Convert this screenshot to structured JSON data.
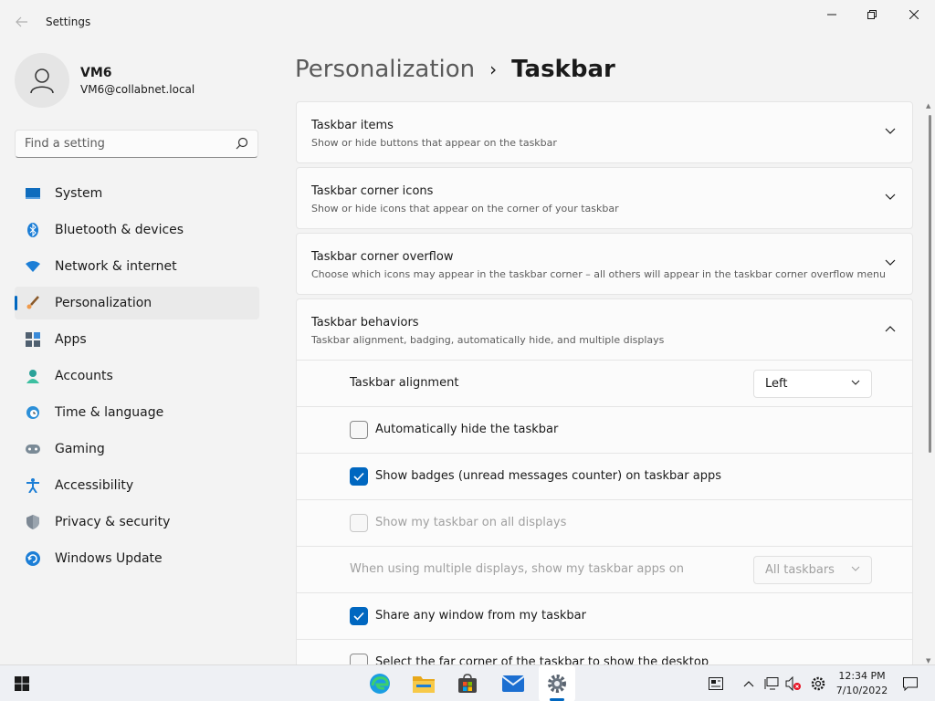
{
  "window": {
    "title": "Settings"
  },
  "profile": {
    "name": "VM6",
    "email": "VM6@collabnet.local"
  },
  "search": {
    "placeholder": "Find a setting"
  },
  "nav": {
    "items": [
      {
        "label": "System",
        "icon": "monitor-icon"
      },
      {
        "label": "Bluetooth & devices",
        "icon": "bluetooth-icon"
      },
      {
        "label": "Network & internet",
        "icon": "wifi-icon"
      },
      {
        "label": "Personalization",
        "icon": "brush-icon",
        "active": true
      },
      {
        "label": "Apps",
        "icon": "apps-icon"
      },
      {
        "label": "Accounts",
        "icon": "person-icon"
      },
      {
        "label": "Time & language",
        "icon": "clock-globe-icon"
      },
      {
        "label": "Gaming",
        "icon": "gamepad-icon"
      },
      {
        "label": "Accessibility",
        "icon": "accessibility-icon"
      },
      {
        "label": "Privacy & security",
        "icon": "shield-icon"
      },
      {
        "label": "Windows Update",
        "icon": "update-icon"
      }
    ]
  },
  "header": {
    "parent": "Personalization",
    "separator": "›",
    "current": "Taskbar"
  },
  "sections": [
    {
      "title": "Taskbar items",
      "description": "Show or hide buttons that appear on the taskbar",
      "expanded": false
    },
    {
      "title": "Taskbar corner icons",
      "description": "Show or hide icons that appear on the corner of your taskbar",
      "expanded": false
    },
    {
      "title": "Taskbar corner overflow",
      "description": "Choose which icons may appear in the taskbar corner – all others will appear in the taskbar corner overflow menu",
      "expanded": false
    },
    {
      "title": "Taskbar behaviors",
      "description": "Taskbar alignment, badging, automatically hide, and multiple displays",
      "expanded": true
    }
  ],
  "behaviors": {
    "alignment_label": "Taskbar alignment",
    "alignment_value": "Left",
    "auto_hide": {
      "label": "Automatically hide the taskbar",
      "checked": false
    },
    "badges": {
      "label": "Show badges (unread messages counter) on taskbar apps",
      "checked": true
    },
    "all_displays": {
      "label": "Show my taskbar on all displays",
      "checked": false,
      "disabled": true
    },
    "multi_display_label": "When using multiple displays, show my taskbar apps on",
    "multi_display_value": "All taskbars",
    "share_window": {
      "label": "Share any window from my taskbar",
      "checked": true
    },
    "far_corner": {
      "label": "Select the far corner of the taskbar to show the desktop",
      "checked": false
    }
  },
  "taskbar": {
    "apps": [
      "windows-start-icon",
      "edge-icon",
      "file-explorer-icon",
      "store-icon",
      "mail-icon",
      "settings-icon"
    ],
    "time": "12:34 PM",
    "date": "7/10/2022"
  },
  "colors": {
    "accent": "#0067c0",
    "background": "#f3f3f3",
    "card": "#fbfbfb"
  }
}
